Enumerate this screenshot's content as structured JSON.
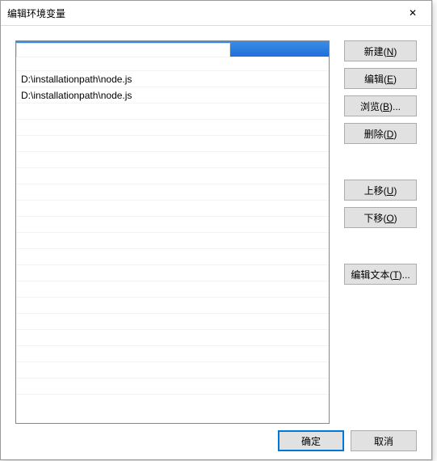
{
  "title": "编辑环境变量",
  "list": {
    "items": [
      {
        "text": "",
        "selected": true
      },
      {
        "text": "D:\\installationpath\\node.js"
      },
      {
        "text": "D:\\installationpath\\node.js"
      }
    ]
  },
  "buttons": {
    "new": "新建(N)",
    "edit": "编辑(E)",
    "browse": "浏览(B)...",
    "delete": "删除(D)",
    "moveup": "上移(U)",
    "movedown": "下移(O)",
    "edittext": "编辑文本(T)..."
  },
  "footer": {
    "ok": "确定",
    "cancel": "取消"
  },
  "close_glyph": "✕"
}
